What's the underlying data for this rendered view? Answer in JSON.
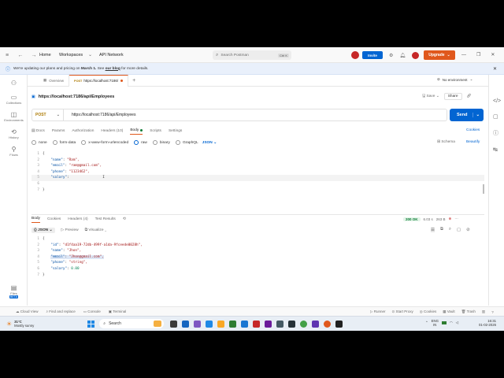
{
  "topbar": {
    "home": "Home",
    "workspaces": "Workspaces",
    "api_network": "API Network",
    "search_placeholder": "Search Postman",
    "search_shortcut": "Ctrl K",
    "invite": "Invite",
    "upgrade": "Upgrade"
  },
  "banner": {
    "text_before": "We're updating our plans and pricing on ",
    "date": "March 1.",
    "text_mid": " See ",
    "link": "our blog",
    "text_after": " for more details."
  },
  "sidebar": {
    "items": [
      "Collections",
      "Environments",
      "History",
      "Flows"
    ],
    "files": "Files",
    "beta": "BETA"
  },
  "tabs": {
    "overview": "Overview",
    "active_method": "POST",
    "active_label": "https://localhost:7186/",
    "environment": "No environment"
  },
  "request": {
    "title": "https://localhost:7186/api/Employees",
    "save": "Save",
    "share": "Share",
    "method": "POST",
    "url": "https://localhost:7186/api/Employees",
    "send": "Send",
    "tabs": [
      "Docs",
      "Params",
      "Authorization",
      "Headers (10)",
      "Body",
      "Scripts",
      "Settings"
    ],
    "cookies": "Cookies",
    "body_types": [
      "none",
      "form-data",
      "x-www-form-urlencoded",
      "raw",
      "binary",
      "GraphQL"
    ],
    "format": "JSON",
    "schema": "Schema",
    "beautify": "Beautify",
    "code": [
      {
        "n": "1",
        "t": "{"
      },
      {
        "n": "2",
        "k": "\"name\"",
        "v": "\"Ram\","
      },
      {
        "n": "3",
        "k": "\"email\"",
        "v": "\"ram@gmail.com\","
      },
      {
        "n": "4",
        "k": "\"phone\"",
        "v": "\"1123462\","
      },
      {
        "n": "5",
        "k": "\"salary\"",
        "v": ""
      },
      {
        "n": "6",
        "t": ""
      },
      {
        "n": "7",
        "t": "}"
      }
    ]
  },
  "response": {
    "tabs": [
      "Body",
      "Cookies",
      "Headers (4)",
      "Test Results"
    ],
    "status": "200 OK",
    "time": "6.03 s",
    "size": "263 B",
    "format": "JSON",
    "preview": "Preview",
    "visualize": "Visualize",
    "code": [
      {
        "n": "1",
        "t": "{"
      },
      {
        "n": "2",
        "k": "\"id\"",
        "v": "\"d1f4aa19-72db-499f-a1da-9fceede0028h\","
      },
      {
        "n": "3",
        "k": "\"name\"",
        "v": "\"Jhon\","
      },
      {
        "n": "4",
        "k": "\"email\"",
        "v": "\"Jhon@gmail.com\","
      },
      {
        "n": "5",
        "k": "\"phone\"",
        "v": "\"string\","
      },
      {
        "n": "6",
        "k": "\"salary\"",
        "num": "0.00"
      },
      {
        "n": "7",
        "t": "}"
      }
    ]
  },
  "statusbar": {
    "left": [
      "Cloud View",
      "Find and replace",
      "Console",
      "Terminal"
    ],
    "right": [
      "Runner",
      "Start Proxy",
      "Cookies",
      "Vault",
      "Trash"
    ]
  },
  "taskbar": {
    "temp": "31°C",
    "weather": "Mostly sunny",
    "search": "Search",
    "lang": "ENG",
    "region": "IN",
    "time": "16:31",
    "date": "01-02-2026"
  }
}
